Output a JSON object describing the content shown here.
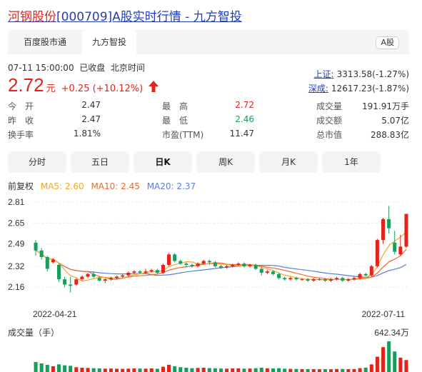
{
  "page": {
    "title_highlight": "河钢股份",
    "title_rest": "[000709]A股实时行情 - 九方智投"
  },
  "tabs": {
    "items": [
      "百度股市通",
      "九方智投"
    ],
    "badge": "A股"
  },
  "quote": {
    "time": "07-11 15:00:00",
    "status": "已收盘",
    "tz": "北京时间",
    "price": "2.72",
    "unit": "元",
    "change": "+0.25 (+10.12%)"
  },
  "indices": [
    {
      "label": "上证:",
      "value": "3313.58(-1.27%)"
    },
    {
      "label": "深成:",
      "value": "12617.23(-1.87%)"
    }
  ],
  "stats": [
    [
      {
        "l": "今　开",
        "v": "2.47"
      },
      {
        "l": "最　高",
        "v": "2.72"
      },
      {
        "l": "成交量",
        "v": "191.91万手"
      }
    ],
    [
      {
        "l": "昨　收",
        "v": "2.47"
      },
      {
        "l": "最　低",
        "v": "2.46"
      },
      {
        "l": "成交额",
        "v": "5.07亿"
      }
    ],
    [
      {
        "l": "换手率",
        "v": "1.81%"
      },
      {
        "l": "市盈(TTM)",
        "v": "11.47"
      },
      {
        "l": "总市值",
        "v": "288.83亿"
      }
    ]
  ],
  "periods": [
    "分时",
    "五日",
    "日K",
    "周K",
    "月K",
    "1年"
  ],
  "active_period": "日K",
  "ma_legend": {
    "label": "前复权",
    "ma5": "MA5: 2.60",
    "ma10": "MA10: 2.45",
    "ma20": "MA20: 2.37"
  },
  "colors": {
    "up": "#e1251b",
    "down": "#1a9c5b",
    "ma5": "#f5a623",
    "ma10": "#f06a2a",
    "ma20": "#5a7be0",
    "link": "#2440b3"
  },
  "chart_data": {
    "type": "candlestick",
    "y_ticks": [
      "2.81",
      "2.65",
      "2.49",
      "2.32",
      "2.16"
    ],
    "ylim": [
      2.09,
      2.81
    ],
    "x_labels": [
      "2022-04-21",
      "2022-07-11"
    ],
    "volume_label": "成交量（手）",
    "volume_max_label": "642.34万",
    "candles": [
      [
        2.5,
        2.44,
        2.52,
        2.4
      ],
      [
        2.44,
        2.39,
        2.46,
        2.37
      ],
      [
        2.39,
        2.3,
        2.4,
        2.28
      ],
      [
        2.35,
        2.37,
        2.38,
        2.34
      ],
      [
        2.33,
        2.22,
        2.34,
        2.2
      ],
      [
        2.22,
        2.18,
        2.24,
        2.16
      ],
      [
        2.18,
        2.17,
        2.24,
        2.12
      ],
      [
        2.18,
        2.22,
        2.23,
        2.17
      ],
      [
        2.22,
        2.24,
        2.25,
        2.21
      ],
      [
        2.24,
        2.26,
        2.27,
        2.23
      ],
      [
        2.26,
        2.24,
        2.28,
        2.23
      ],
      [
        2.23,
        2.21,
        2.24,
        2.2
      ],
      [
        2.21,
        2.22,
        2.23,
        2.19
      ],
      [
        2.22,
        2.23,
        2.24,
        2.21
      ],
      [
        2.23,
        2.24,
        2.25,
        2.22
      ],
      [
        2.24,
        2.25,
        2.26,
        2.23
      ],
      [
        2.25,
        2.27,
        2.28,
        2.24
      ],
      [
        2.27,
        2.28,
        2.29,
        2.26
      ],
      [
        2.28,
        2.27,
        2.29,
        2.26
      ],
      [
        2.27,
        2.28,
        2.3,
        2.26
      ],
      [
        2.28,
        2.29,
        2.3,
        2.27
      ],
      [
        2.29,
        2.27,
        2.3,
        2.26
      ],
      [
        2.27,
        2.33,
        2.34,
        2.26
      ],
      [
        2.33,
        2.41,
        2.42,
        2.32
      ],
      [
        2.41,
        2.36,
        2.42,
        2.35
      ],
      [
        2.36,
        2.34,
        2.37,
        2.33
      ],
      [
        2.34,
        2.33,
        2.35,
        2.31
      ],
      [
        2.33,
        2.32,
        2.34,
        2.31
      ],
      [
        2.32,
        2.34,
        2.35,
        2.31
      ],
      [
        2.34,
        2.36,
        2.37,
        2.33
      ],
      [
        2.36,
        2.35,
        2.37,
        2.33
      ],
      [
        2.35,
        2.32,
        2.36,
        2.31
      ],
      [
        2.32,
        2.31,
        2.33,
        2.3
      ],
      [
        2.31,
        2.32,
        2.33,
        2.3
      ],
      [
        2.32,
        2.33,
        2.34,
        2.31
      ],
      [
        2.33,
        2.34,
        2.35,
        2.32
      ],
      [
        2.34,
        2.32,
        2.35,
        2.31
      ],
      [
        2.32,
        2.33,
        2.34,
        2.31
      ],
      [
        2.33,
        2.3,
        2.34,
        2.29
      ],
      [
        2.3,
        2.27,
        2.31,
        2.25
      ],
      [
        2.27,
        2.28,
        2.29,
        2.26
      ],
      [
        2.28,
        2.26,
        2.29,
        2.25
      ],
      [
        2.26,
        2.23,
        2.27,
        2.22
      ],
      [
        2.23,
        2.22,
        2.24,
        2.21
      ],
      [
        2.22,
        2.23,
        2.24,
        2.21
      ],
      [
        2.23,
        2.22,
        2.24,
        2.21
      ],
      [
        2.22,
        2.22,
        2.23,
        2.21
      ],
      [
        2.22,
        2.21,
        2.23,
        2.2
      ],
      [
        2.21,
        2.22,
        2.23,
        2.2
      ],
      [
        2.22,
        2.22,
        2.23,
        2.21
      ],
      [
        2.22,
        2.21,
        2.23,
        2.2
      ],
      [
        2.21,
        2.22,
        2.23,
        2.2
      ],
      [
        2.22,
        2.23,
        2.24,
        2.21
      ],
      [
        2.23,
        2.21,
        2.24,
        2.2
      ],
      [
        2.21,
        2.22,
        2.23,
        2.2
      ],
      [
        2.22,
        2.23,
        2.24,
        2.21
      ],
      [
        2.23,
        2.26,
        2.27,
        2.22
      ],
      [
        2.26,
        2.25,
        2.27,
        2.24
      ],
      [
        2.25,
        2.32,
        2.33,
        2.24
      ],
      [
        2.32,
        2.52,
        2.53,
        2.31
      ],
      [
        2.52,
        2.68,
        2.69,
        2.49
      ],
      [
        2.68,
        2.61,
        2.78,
        2.57
      ],
      [
        2.5,
        2.43,
        2.59,
        2.41
      ],
      [
        2.41,
        2.47,
        2.56,
        2.4
      ],
      [
        2.47,
        2.72,
        2.72,
        2.46
      ]
    ],
    "volumes": [
      210,
      180,
      150,
      120,
      160,
      140,
      130,
      100,
      90,
      85,
      80,
      75,
      70,
      72,
      68,
      66,
      70,
      74,
      72,
      70,
      76,
      68,
      110,
      150,
      120,
      100,
      90,
      80,
      85,
      90,
      82,
      78,
      72,
      70,
      74,
      76,
      70,
      72,
      80,
      90,
      78,
      74,
      80,
      70,
      66,
      64,
      60,
      62,
      60,
      58,
      60,
      58,
      62,
      64,
      60,
      62,
      80,
      90,
      160,
      320,
      520,
      642,
      430,
      300,
      250
    ]
  }
}
